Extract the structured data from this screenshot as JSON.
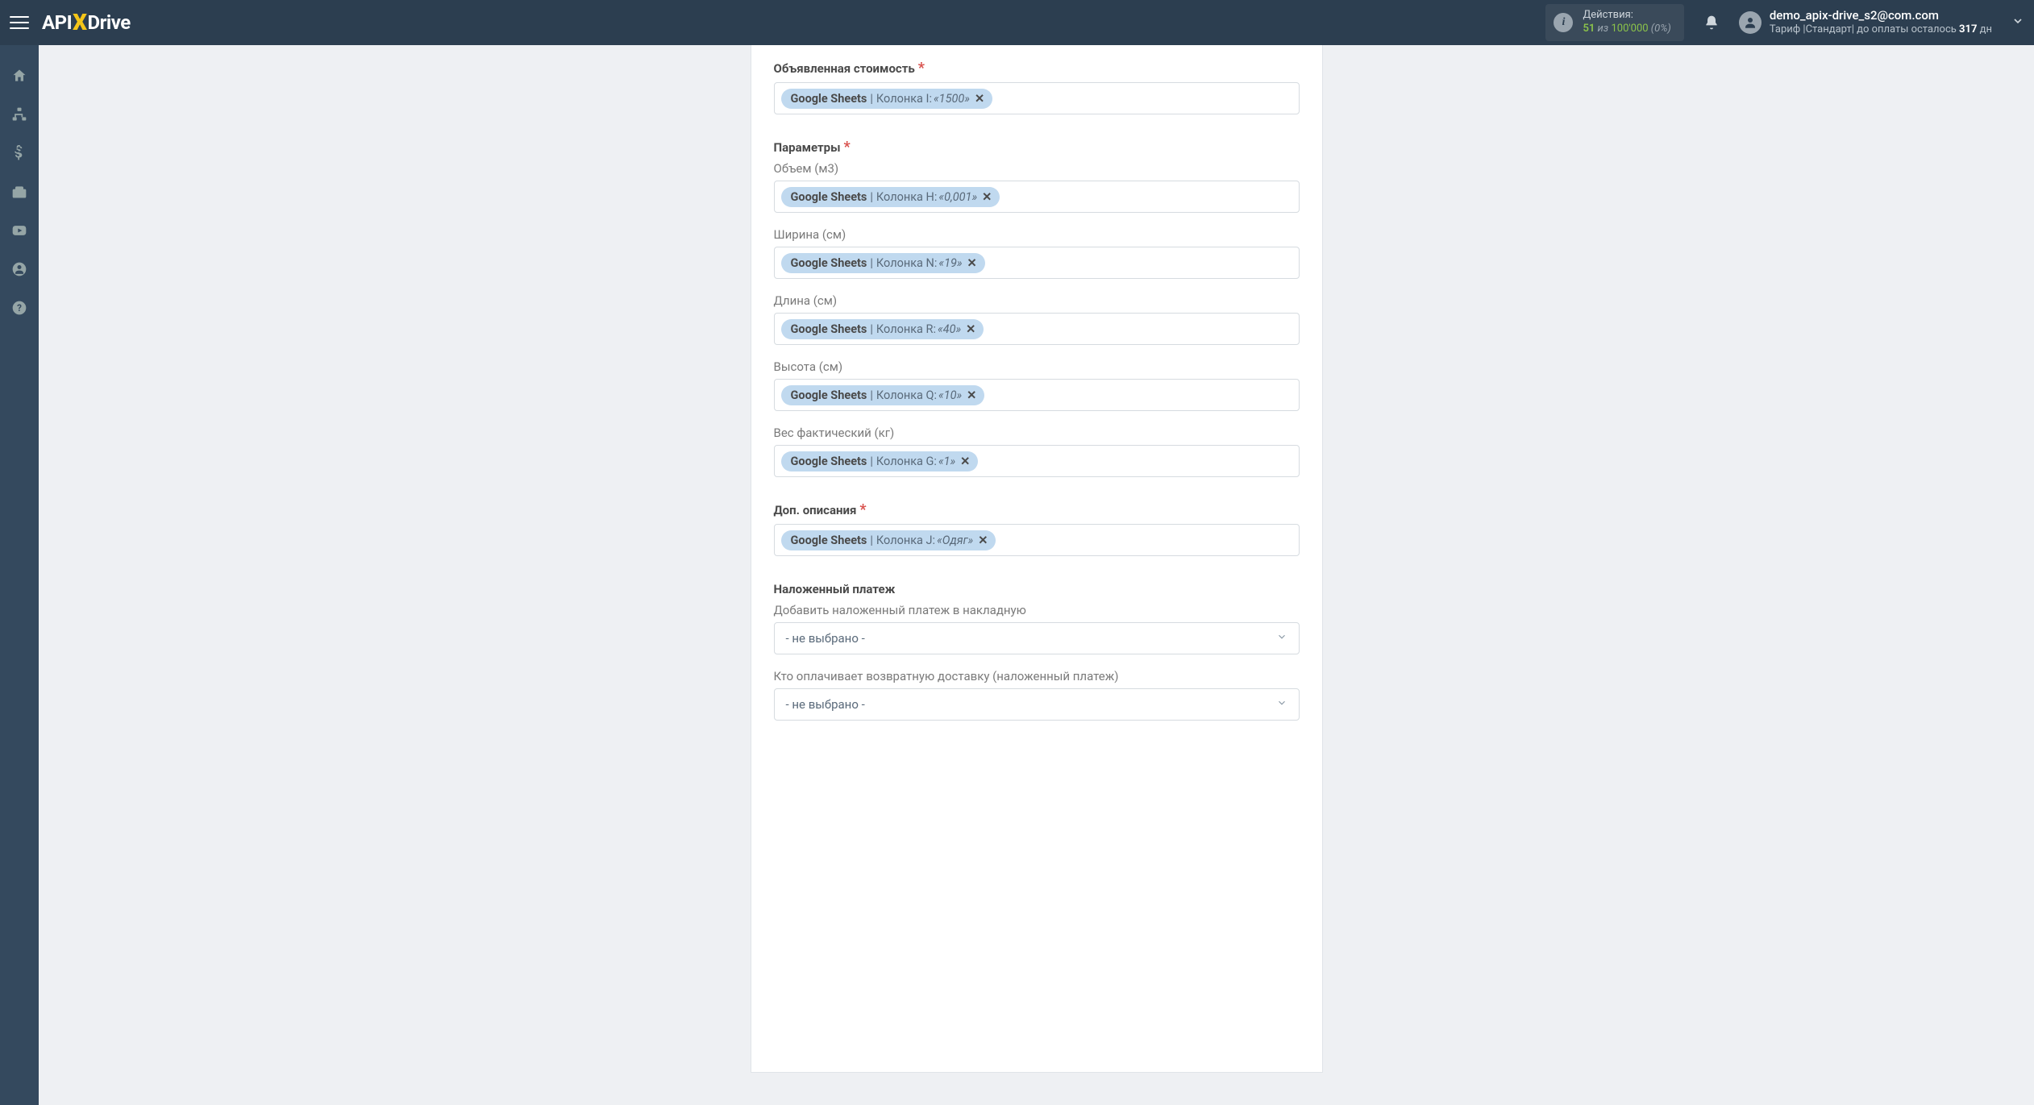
{
  "header": {
    "logo_api": "API",
    "logo_x": "X",
    "logo_drive": "Drive",
    "actions_label": "Действия:",
    "actions_count": "51",
    "actions_of": "из",
    "actions_total": "100'000",
    "actions_pct": "(0%)"
  },
  "user": {
    "email": "demo_apix-drive_s2@com.com",
    "tariff_prefix": "Тариф |Стандарт| до оплаты осталось ",
    "tariff_days": "317",
    "tariff_suffix": " дн"
  },
  "form": {
    "declared_cost": {
      "label": "Объявленная стоимость",
      "tag_source": "Google Sheets",
      "tag_column": "Колонка I:",
      "tag_value": "«1500»"
    },
    "params_label": "Параметры",
    "volume": {
      "label": "Объем (м3)",
      "tag_source": "Google Sheets",
      "tag_column": "Колонка H:",
      "tag_value": "«0,001»"
    },
    "width": {
      "label": "Ширина (см)",
      "tag_source": "Google Sheets",
      "tag_column": "Колонка N:",
      "tag_value": "«19»"
    },
    "length": {
      "label": "Длина (см)",
      "tag_source": "Google Sheets",
      "tag_column": "Колонка R:",
      "tag_value": "«40»"
    },
    "height": {
      "label": "Высота (см)",
      "tag_source": "Google Sheets",
      "tag_column": "Колонка Q:",
      "tag_value": "«10»"
    },
    "weight": {
      "label": "Вес фактический (кг)",
      "tag_source": "Google Sheets",
      "tag_column": "Колонка G:",
      "tag_value": "«1»"
    },
    "extra_desc": {
      "label": "Доп. описания",
      "tag_source": "Google Sheets",
      "tag_column": "Колонка J:",
      "tag_value": "«Одяг»"
    },
    "cod_section_label": "Наложенный платеж",
    "cod_add": {
      "label": "Добавить наложенный платеж в накладную",
      "placeholder": "- не выбрано -"
    },
    "cod_payer": {
      "label": "Кто оплачивает возвратную доставку (наложенный платеж)",
      "placeholder": "- не выбрано -"
    }
  }
}
